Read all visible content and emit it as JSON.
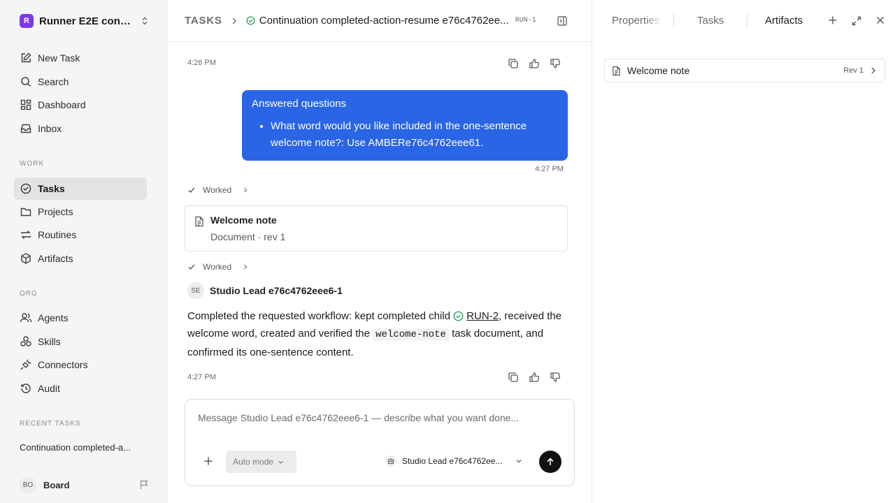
{
  "sidebar": {
    "workspace": {
      "logo_letter": "R",
      "name": "Runner E2E conti..."
    },
    "primary": [
      {
        "label": "New Task",
        "icon": "edit-icon"
      },
      {
        "label": "Search",
        "icon": "search-icon"
      },
      {
        "label": "Dashboard",
        "icon": "dashboard-icon"
      },
      {
        "label": "Inbox",
        "icon": "inbox-icon"
      }
    ],
    "work_label": "WORK",
    "work": [
      {
        "label": "Tasks",
        "icon": "check-circle-icon",
        "active": true
      },
      {
        "label": "Projects",
        "icon": "folder-icon"
      },
      {
        "label": "Routines",
        "icon": "repeat-icon"
      },
      {
        "label": "Artifacts",
        "icon": "cube-icon"
      }
    ],
    "org_label": "ORG",
    "org": [
      {
        "label": "Agents",
        "icon": "users-icon"
      },
      {
        "label": "Skills",
        "icon": "skills-icon"
      },
      {
        "label": "Connectors",
        "icon": "plug-icon"
      },
      {
        "label": "Audit",
        "icon": "history-icon"
      }
    ],
    "recent_label": "RECENT TASKS",
    "recent": [
      "Continuation completed-a..."
    ],
    "user": {
      "initials": "BO",
      "name": "Board"
    }
  },
  "header": {
    "root": "TASKS",
    "title": "Continuation completed-action-resume e76c4762ee...",
    "task_id": "RUN-1"
  },
  "thread": {
    "first_time": "4:26 PM",
    "user_message": {
      "title": "Answered questions",
      "items": [
        "What word would you like included in the one-sentence welcome note?: Use AMBERe76c4762eee61."
      ],
      "time": "4:27 PM"
    },
    "worked_1": "Worked",
    "doc_card": {
      "title": "Welcome note",
      "meta": "Document · rev 1"
    },
    "worked_2": "Worked",
    "agent": {
      "initials": "SE",
      "name": "Studio Lead e76c4762eee6-1"
    },
    "reply": {
      "part1": "Completed the requested workflow: kept completed child ",
      "link": "RUN-2",
      "part2": ", received the welcome word, created and verified the ",
      "code": "welcome-note",
      "part3": " task document, and confirmed its one-sentence content."
    },
    "reply_time": "4:27 PM"
  },
  "composer": {
    "placeholder": "Message Studio Lead e76c4762eee6-1 — describe what you want done...",
    "mode": "Auto mode",
    "agent": "Studio Lead e76c4762ee..."
  },
  "right_panel": {
    "tabs": [
      "Properties",
      "Tasks",
      "Artifacts"
    ],
    "active_tab": "Artifacts",
    "artifact": {
      "name": "Welcome note",
      "rev": "Rev 1"
    }
  },
  "colors": {
    "accent": "#2a65e6",
    "workspace_logo": "#7c3aed",
    "success": "#22a05b"
  }
}
